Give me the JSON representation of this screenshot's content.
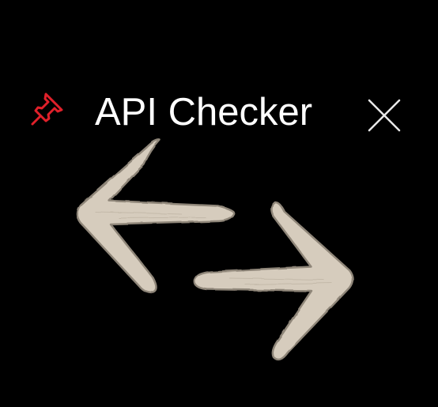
{
  "app": {
    "title": "API Checker"
  },
  "icons": {
    "pin": "pushpin-icon",
    "close": "close-icon",
    "logo": "swap-arrows-icon"
  },
  "colors": {
    "background": "#000000",
    "title_text": "#ffffff",
    "pin_accent": "#e0202a",
    "close_icon": "#e8e8e8",
    "arrow_fill": "#d6ccbd",
    "arrow_outline": "#8f8679"
  }
}
